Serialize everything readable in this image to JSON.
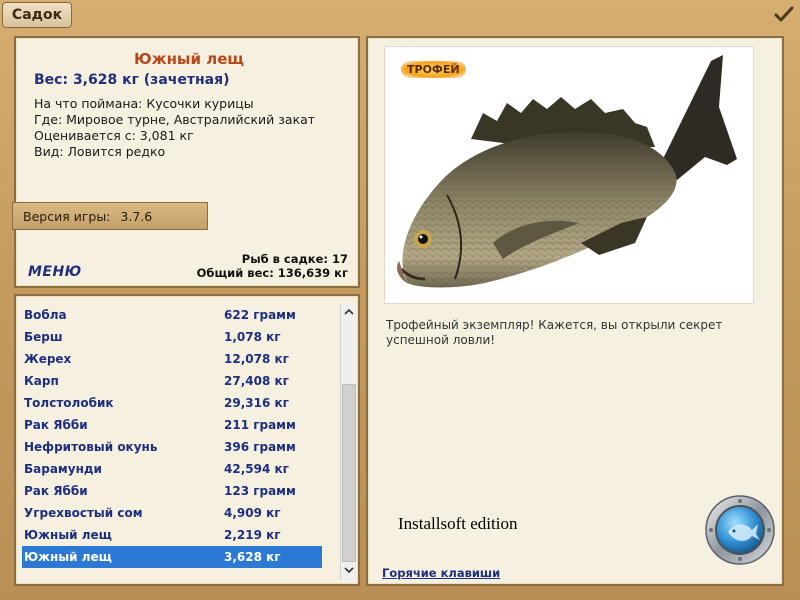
{
  "window": {
    "title": "Садок"
  },
  "info": {
    "fish_name": "Южный лещ",
    "weight": "Вес: 3,628 кг (зачетная)",
    "details": [
      "На что поймана: Кусочки курицы",
      "Где: Мировое турне, Австралийский закат",
      "Оценивается с: 3,081 кг",
      "Вид: Ловится редко"
    ],
    "version_label": "Версия игры:",
    "version_value": "3.7.6",
    "menu_label": "МЕНЮ",
    "fish_count": "Рыб в садке: 17",
    "total_weight": "Общий вес: 136,639 кг"
  },
  "list": {
    "selected_index": 11,
    "items": [
      {
        "name": "Вобла",
        "weight": "622 грамм"
      },
      {
        "name": "Берш",
        "weight": "1,078 кг"
      },
      {
        "name": "Жерех",
        "weight": "12,078 кг"
      },
      {
        "name": "Карп",
        "weight": "27,408 кг"
      },
      {
        "name": "Толстолобик",
        "weight": "29,316 кг"
      },
      {
        "name": "Рак Ябби",
        "weight": "211 грамм"
      },
      {
        "name": "Нефритовый окунь",
        "weight": "396 грамм"
      },
      {
        "name": "Барамунди",
        "weight": "42,594 кг"
      },
      {
        "name": "Рак Ябби",
        "weight": "123 грамм"
      },
      {
        "name": "Угрехвостый сом",
        "weight": "4,909 кг"
      },
      {
        "name": "Южный лещ",
        "weight": "2,219 кг"
      },
      {
        "name": "Южный лещ",
        "weight": "3,628 кг"
      }
    ]
  },
  "trophy": {
    "badge": "ТРОФЕЙ",
    "text": "Трофейный экземпляр! Кажется, вы открыли секрет успешной ловли!",
    "edition": "Installsoft edition",
    "hotkeys": "Горячие клавиши"
  },
  "icons": {
    "close": "checkmark-icon",
    "scroll_up": "chevron-up-icon",
    "scroll_down": "chevron-down-icon",
    "porthole": "porthole-fish-icon",
    "fish_image": "bream-fish-image"
  },
  "colors": {
    "accent_title": "#b8481a",
    "link": "#1d2f7e",
    "selection": "#2b79d3",
    "frame": "#c39a5e"
  }
}
